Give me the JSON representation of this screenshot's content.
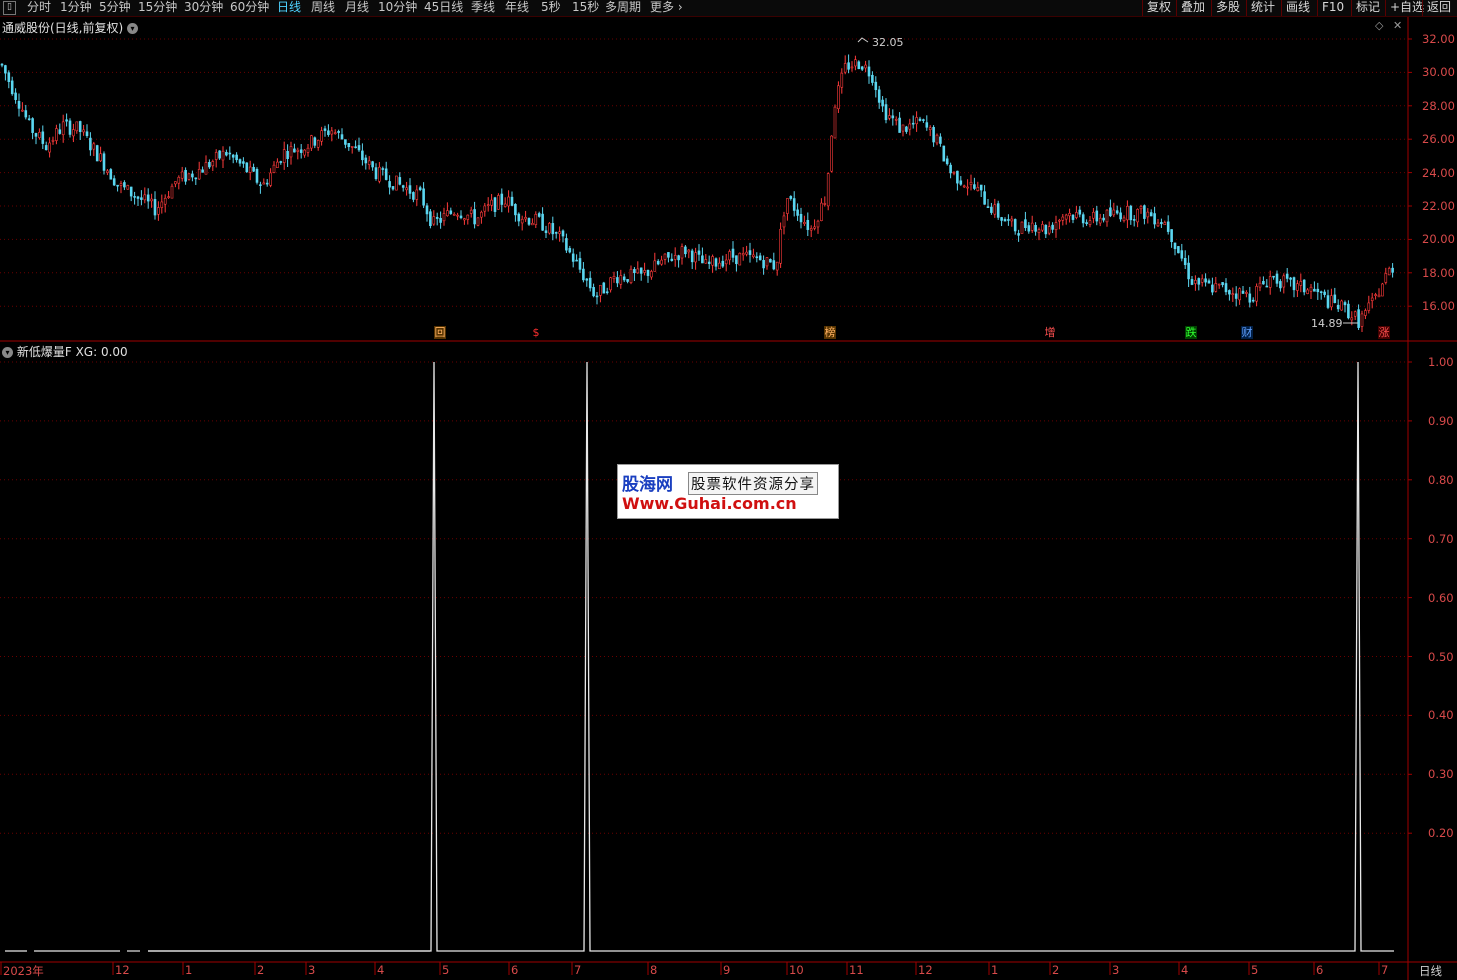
{
  "toolbar": {
    "periods": [
      "分时",
      "1分钟",
      "5分钟",
      "15分钟",
      "30分钟",
      "60分钟",
      "日线",
      "周线",
      "月线",
      "10分钟",
      "45日线",
      "季线",
      "年线",
      "5秒",
      "15秒",
      "多周期",
      "更多"
    ],
    "active_period": "日线",
    "right_buttons": [
      "复权",
      "叠加",
      "多股",
      "统计",
      "画线",
      "F10",
      "标记",
      "+自选",
      "返回"
    ]
  },
  "price_panel": {
    "title": "通威股份(日线,前复权)",
    "high_label": "32.05",
    "low_label": "14.89",
    "y_ticks": [
      "32.00",
      "30.00",
      "28.00",
      "26.00",
      "24.00",
      "22.00",
      "20.00",
      "18.00",
      "16.00"
    ],
    "events": [
      {
        "text": "回",
        "color": "#ffb060",
        "bg": "#553300"
      },
      {
        "text": "$",
        "color": "#ff3030",
        "bg": "transparent"
      },
      {
        "text": "榜",
        "color": "#ffb060",
        "bg": "#553300"
      },
      {
        "text": "增",
        "color": "#ff5050",
        "bg": "transparent"
      },
      {
        "text": "跌",
        "color": "#30ff30",
        "bg": "#004400"
      },
      {
        "text": "财",
        "color": "#60a0ff",
        "bg": "#001e44"
      },
      {
        "text": "涨",
        "color": "#ff5050",
        "bg": "#440000"
      }
    ],
    "colors": {
      "up": "#ff3b3b",
      "down": "#5bd6f0",
      "grid": "#6a0000",
      "axis": "#a00000"
    }
  },
  "indicator_panel": {
    "title": "新低爆量F",
    "value_label": "XG: 0.00",
    "y_ticks": [
      "1.00",
      "0.90",
      "0.80",
      "0.70",
      "0.60",
      "0.50",
      "0.40",
      "0.30",
      "0.20"
    ]
  },
  "x_axis": [
    "2023年",
    "12",
    "1",
    "2",
    "3",
    "4",
    "5",
    "6",
    "7",
    "8",
    "9",
    "10",
    "11",
    "12",
    "1",
    "2",
    "3",
    "4",
    "5",
    "6",
    "7"
  ],
  "status_label": "日线",
  "watermark": {
    "line1": "股海网",
    "line2": "股票软件资源分享",
    "line3": "Www.Guhai.com.cn"
  }
}
